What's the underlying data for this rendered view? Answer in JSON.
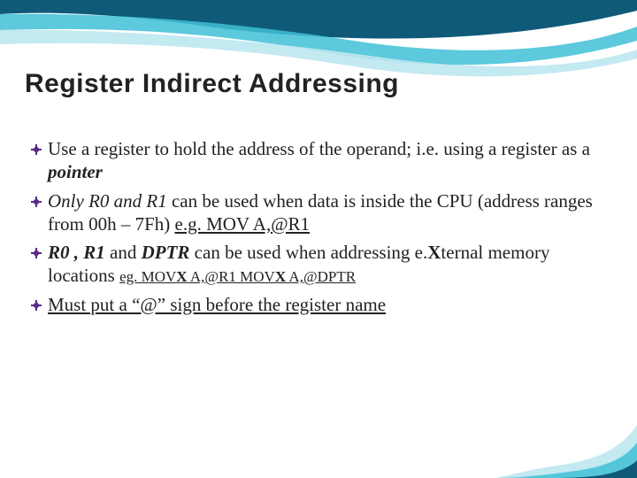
{
  "title": "Register Indirect Addressing",
  "bullets": {
    "b1_a": "Use a register to hold the address of the operand; i.e. using a register as a ",
    "b1_b": "pointer",
    "b2_a": "Only R0 and R1",
    "b2_b": " can be used when data is inside the CPU (address ranges from 00h – 7Fh)  ",
    "b2_c": "e.g.  MOV  A,@R1",
    "b3_a": "R0 , R1",
    "b3_b": " and ",
    "b3_c": "DPTR",
    "b3_d": " can be used when addressing e.",
    "b3_e": "X",
    "b3_f": "ternal memory locations  ",
    "b3_g": "eg. MOV",
    "b3_h": "X",
    "b3_i": "  A,@R1    MOV",
    "b3_j": "X",
    "b3_k": " A,@DPTR",
    "b4": "Must put a “@” sign before the register name"
  }
}
